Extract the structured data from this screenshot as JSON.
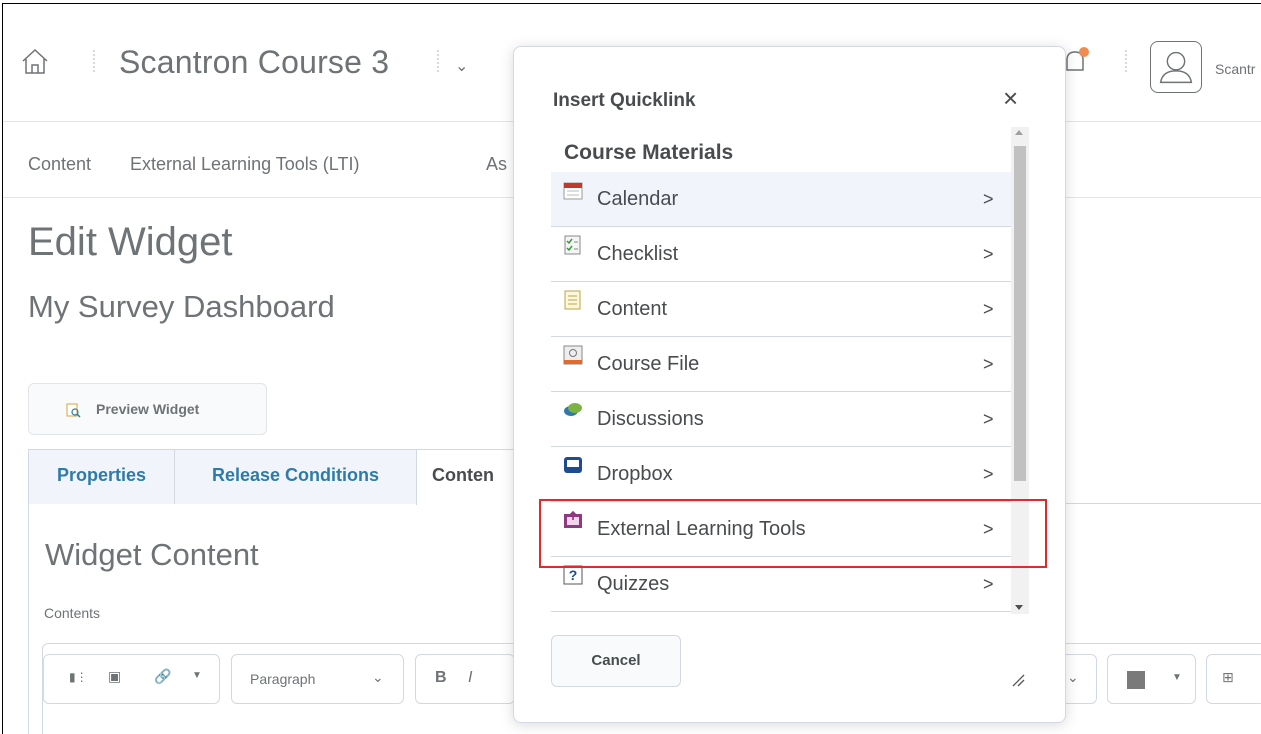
{
  "header": {
    "course_title": "Scantron Course 3",
    "user_name": "Scantr",
    "notification_accent": "#f28b50"
  },
  "navbar": {
    "items": [
      "Content",
      "External Learning Tools (LTI)",
      "As"
    ]
  },
  "page": {
    "title": "Edit Widget",
    "subtitle": "My Survey Dashboard",
    "preview_button": "Preview Widget"
  },
  "tabs": [
    {
      "label": "Properties",
      "active": false
    },
    {
      "label": "Release Conditions",
      "active": false
    },
    {
      "label": "Conten",
      "active": true
    }
  ],
  "content_section": {
    "title": "Widget Content",
    "contents_label": "Contents",
    "toolbar": {
      "paragraph_select": "Paragraph",
      "bold": "B",
      "italic": "I"
    }
  },
  "modal": {
    "title": "Insert Quicklink",
    "close_symbol": "×",
    "list_title": "Course Materials",
    "items": [
      {
        "label": "Calendar",
        "icon": "calendar-icon"
      },
      {
        "label": "Checklist",
        "icon": "checklist-icon"
      },
      {
        "label": "Content",
        "icon": "content-icon"
      },
      {
        "label": "Course File",
        "icon": "course-file-icon"
      },
      {
        "label": "Discussions",
        "icon": "discussions-icon"
      },
      {
        "label": "Dropbox",
        "icon": "dropbox-icon"
      },
      {
        "label": "External Learning Tools",
        "icon": "external-tools-icon",
        "highlighted": true
      },
      {
        "label": "Quizzes",
        "icon": "quizzes-icon"
      }
    ],
    "chevron": ">",
    "cancel_button": "Cancel",
    "highlight_color": "#e02b2b"
  }
}
